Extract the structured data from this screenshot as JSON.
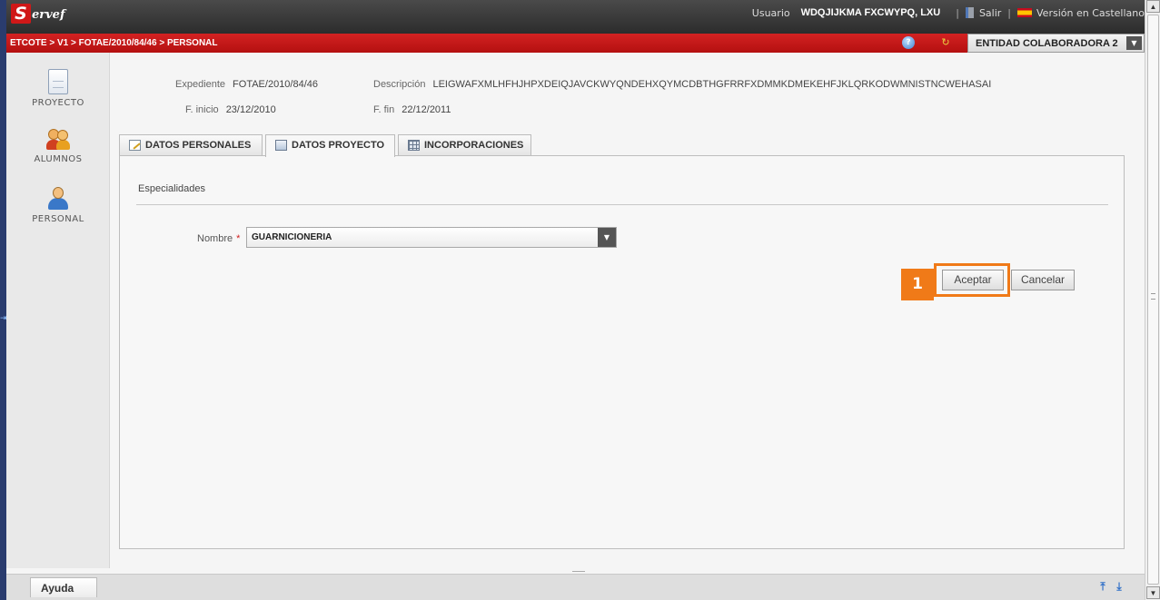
{
  "topbar": {
    "logo_letter": "S",
    "logo_rest": "ervef",
    "usuario_label": "Usuario",
    "usuario_name": "WDQJIJKMA FXCWYPQ, LXU",
    "separator": "|",
    "salir_label": "Salir",
    "version_label": "Versión en Castellano"
  },
  "redbar": {
    "breadcrumb": "ETCOTE > V1 > FOTAE/2010/84/46 > PERSONAL",
    "entity_select_value": "ENTIDAD COLABORADORA 2",
    "help_glyph": "?"
  },
  "sidenav": {
    "items": [
      {
        "label": "PROYECTO",
        "icon": "document-icon"
      },
      {
        "label": "ALUMNOS",
        "icon": "students-icon"
      },
      {
        "label": "PERSONAL",
        "icon": "person-icon"
      }
    ]
  },
  "header": {
    "expediente_label": "Expediente",
    "expediente_value": "FOTAE/2010/84/46",
    "descripcion_label": "Descripción",
    "descripcion_value": "LEIGWAFXMLHFHJHPXDEIQJAVCKWYQNDEHXQYMCDBTHGFRRFXDMMKDMEKEHFJKLQRKODWMNISTNCWEHASAI",
    "finicio_label": "F. inicio",
    "finicio_value": "23/12/2010",
    "ffin_label": "F. fin",
    "ffin_value": "22/12/2011"
  },
  "tabs": [
    {
      "label": "DATOS PERSONALES",
      "icon": "edit-icon",
      "active": false
    },
    {
      "label": "DATOS PROYECTO",
      "icon": "document-icon",
      "active": true
    },
    {
      "label": "INCORPORACIONES",
      "icon": "grid-icon",
      "active": false
    }
  ],
  "panel": {
    "section_title": "Especialidades",
    "nombre_label": "Nombre",
    "required_mark": "*",
    "nombre_value": "GUARNICIONERIA",
    "badge": "1",
    "accept_label": "Aceptar",
    "cancel_label": "Cancelar"
  },
  "bottom": {
    "ayuda_label": "Ayuda"
  },
  "colors": {
    "brand_red": "#c41414",
    "highlight_orange": "#f07a18",
    "nav_blue": "#2f6fc8"
  }
}
